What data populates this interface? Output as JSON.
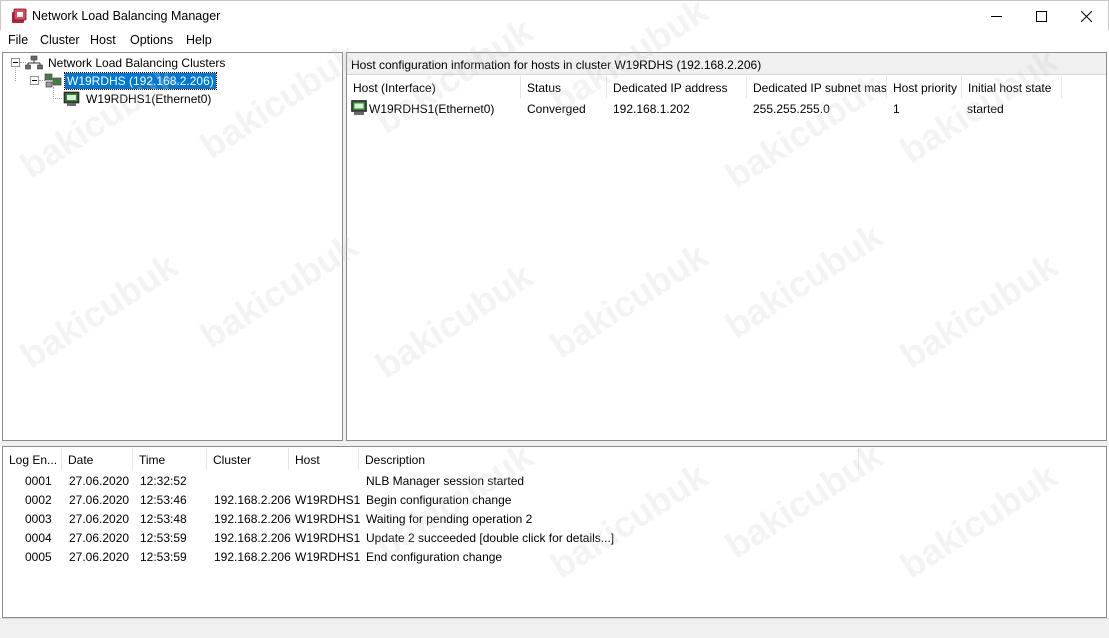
{
  "window": {
    "title": "Network Load Balancing Manager",
    "controls": {
      "minimize": "minimize-icon",
      "maximize": "maximize-icon",
      "close": "close-icon"
    }
  },
  "menu": [
    "File",
    "Cluster",
    "Host",
    "Options",
    "Help"
  ],
  "tree": {
    "root_label": "Network Load Balancing Clusters",
    "cluster_label": "W19RDHS (192.168.2.206)",
    "host_label": "W19RDHS1(Ethernet0)"
  },
  "hosts_panel": {
    "caption": "Host configuration information for hosts in cluster W19RDHS (192.168.2.206)",
    "columns": [
      "Host (Interface)",
      "Status",
      "Dedicated IP address",
      "Dedicated IP subnet mask",
      "Host priority",
      "Initial host state"
    ],
    "rows": [
      [
        "W19RDHS1(Ethernet0)",
        "Converged",
        "192.168.1.202",
        "255.255.255.0",
        "1",
        "started"
      ]
    ]
  },
  "log_panel": {
    "columns": [
      "Log En...",
      "Date",
      "Time",
      "Cluster",
      "Host",
      "Description"
    ],
    "rows": [
      [
        "0001",
        "27.06.2020",
        "12:32:52",
        "",
        "",
        "NLB Manager session started"
      ],
      [
        "0002",
        "27.06.2020",
        "12:53:46",
        "192.168.2.206",
        "W19RDHS1",
        "Begin configuration change"
      ],
      [
        "0003",
        "27.06.2020",
        "12:53:48",
        "192.168.2.206",
        "W19RDHS1",
        "Waiting for pending operation 2"
      ],
      [
        "0004",
        "27.06.2020",
        "12:53:59",
        "192.168.2.206",
        "W19RDHS1",
        "Update 2 succeeded [double click for details...]"
      ],
      [
        "0005",
        "27.06.2020",
        "12:53:59",
        "192.168.2.206",
        "W19RDHS1",
        "End configuration change"
      ]
    ]
  },
  "watermark": "bakicubuk",
  "colors": {
    "selection": "#0078d7",
    "host_icon_green": "#2e8b2e"
  }
}
